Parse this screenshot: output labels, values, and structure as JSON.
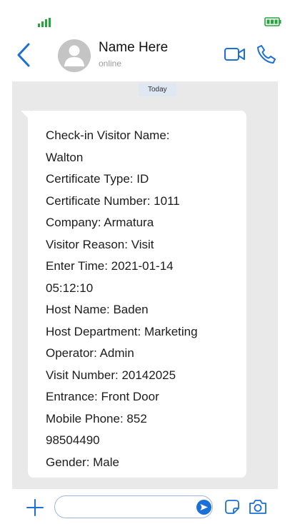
{
  "header": {
    "contact_name": "Name Here",
    "presence": "online"
  },
  "chat": {
    "date_label": "Today",
    "message_lines": [
      "Check-in Visitor Name:",
      "Walton",
      "Certificate Type: ID",
      "Certificate Number: 1011",
      "Company: Armatura",
      "Visitor Reason: Visit",
      "Enter Time: 2021-01-14",
      "05:12:10",
      "Host Name: Baden",
      "Host Department: Marketing",
      "Operator: Admin",
      "Visit Number: 20142025",
      "Entrance: Front Door",
      "Mobile Phone: 852",
      "98504490",
      "Gender: Male"
    ]
  },
  "compose": {
    "placeholder": ""
  },
  "icons": {
    "status_signal": "signal-icon",
    "status_battery": "battery-icon",
    "back": "chevron-left-icon",
    "avatar": "user-avatar-icon",
    "video": "video-camera-icon",
    "phone": "phone-icon",
    "add": "plus-icon",
    "send": "send-icon",
    "sticker": "sticker-icon",
    "camera": "camera-icon"
  },
  "colors": {
    "accent": "#1b6fd8",
    "status_green": "#22a838",
    "chat_background": "#e9e9e9",
    "date_chip": "#dfe7f3"
  }
}
